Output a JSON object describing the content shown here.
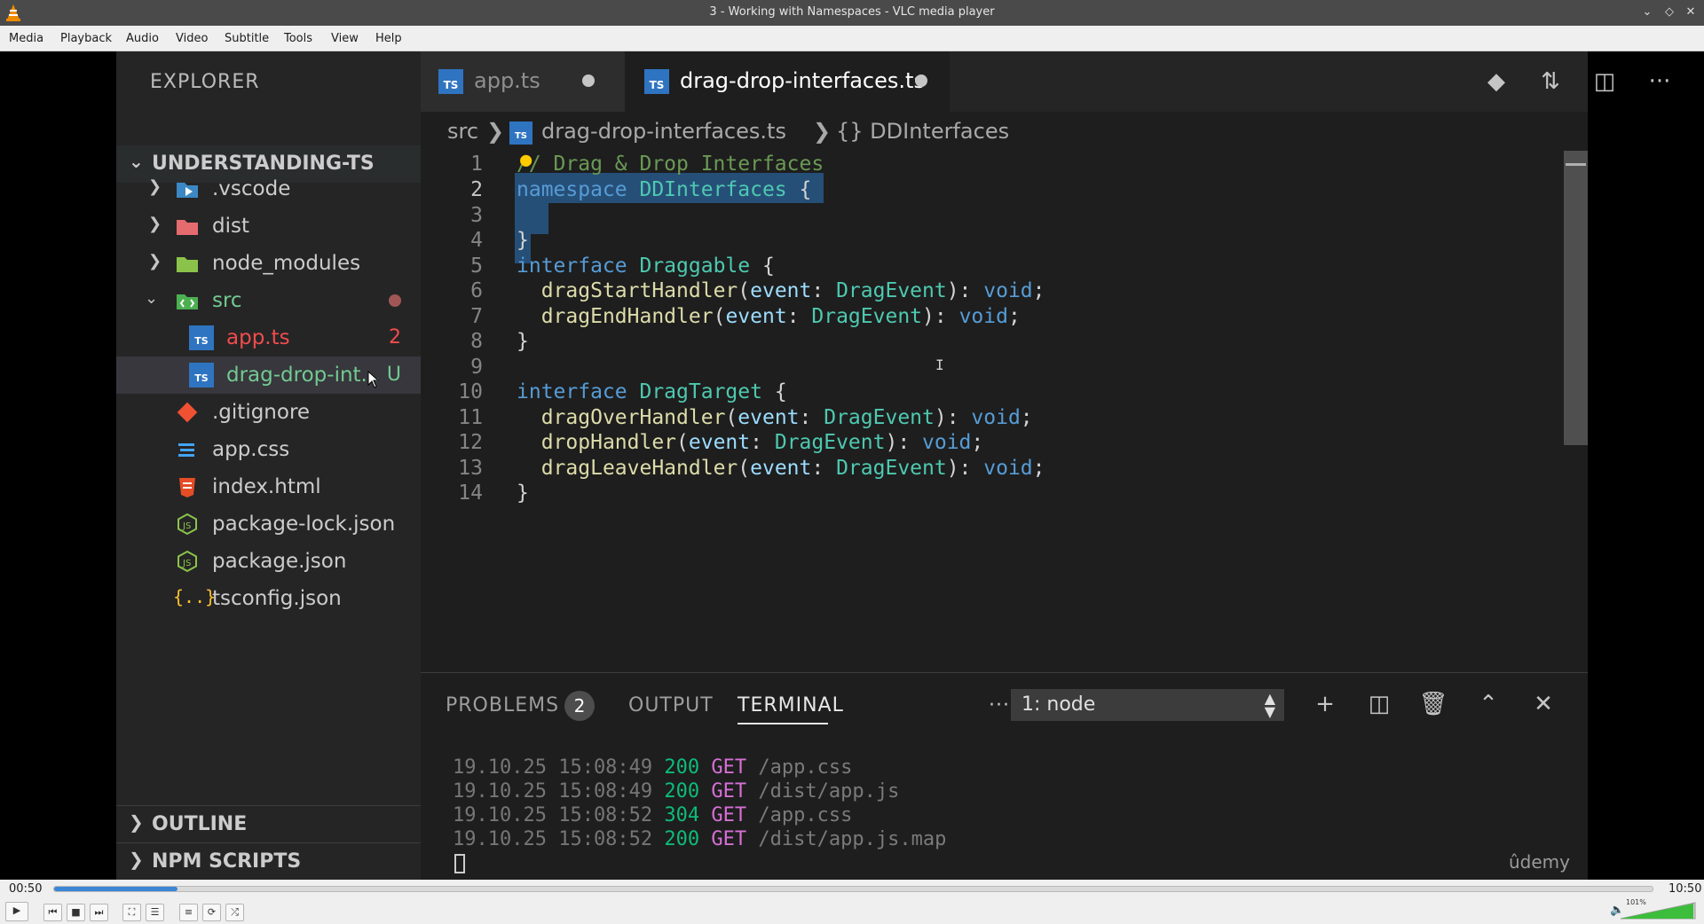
{
  "window": {
    "title": "3 - Working with Namespaces - VLC media player",
    "buttons": [
      "minimize",
      "maximize",
      "close"
    ]
  },
  "menu": [
    "Media",
    "Playback",
    "Audio",
    "Video",
    "Subtitle",
    "Tools",
    "View",
    "Help"
  ],
  "explorer": {
    "header": "EXPLORER",
    "project": "UNDERSTANDING-TS",
    "items": [
      {
        "name": ".vscode",
        "color": "#cccccc"
      },
      {
        "name": "dist",
        "color": "#cccccc"
      },
      {
        "name": "node_modules",
        "color": "#cccccc"
      },
      {
        "name": "src",
        "color": "#73c991"
      },
      {
        "name": "app.ts",
        "badge": "2",
        "color": "#f14c4c"
      },
      {
        "name": "drag-drop-int...",
        "badge": "U",
        "color": "#73c991"
      },
      {
        "name": ".gitignore",
        "color": "#cccccc"
      },
      {
        "name": "app.css",
        "color": "#cccccc"
      },
      {
        "name": "index.html",
        "color": "#cccccc"
      },
      {
        "name": "package-lock.json",
        "color": "#cccccc"
      },
      {
        "name": "package.json",
        "color": "#cccccc"
      },
      {
        "name": "tsconfig.json",
        "color": "#cccccc"
      }
    ],
    "outline": "OUTLINE",
    "npm_scripts": "NPM SCRIPTS"
  },
  "tabs": [
    {
      "name": "app.ts",
      "icon": "TS"
    },
    {
      "name": "drag-drop-interfaces.ts",
      "icon": "TS"
    }
  ],
  "breadcrumb": {
    "folder": "src",
    "file": "drag-drop-interfaces.ts",
    "symbol": "{} DDInterfaces"
  },
  "code": {
    "line_numbers": [
      "1",
      "2",
      "3",
      "4",
      "5",
      "6",
      "7",
      "8",
      "9",
      "10",
      "11",
      "12",
      "13",
      "14"
    ],
    "comment": "// Drag & Drop Interfaces",
    "kw_namespace": "namespace",
    "kw_interface": "interface",
    "ns_name": "DDInterfaces",
    "i1_name": "Draggable",
    "i2_name": "DragTarget",
    "open_brace": "{",
    "close_brace": "}",
    "void": "void",
    "event_param": "event",
    "event_type": "DragEvent",
    "m1": "dragStartHandler",
    "m2": "dragEndHandler",
    "m3": "dragOverHandler",
    "m4": "dropHandler",
    "m5": "dragLeaveHandler"
  },
  "panel": {
    "problems": "PROBLEMS",
    "problems_count": "2",
    "output": "OUTPUT",
    "terminal": "TERMINAL",
    "more": "···",
    "terminal_select": "1: node",
    "log": [
      {
        "ts": "19.10.25 15:08:49",
        "code": "200",
        "method": "GET",
        "path": "/app.css"
      },
      {
        "ts": "19.10.25 15:08:49",
        "code": "200",
        "method": "GET",
        "path": "/dist/app.js"
      },
      {
        "ts": "19.10.25 15:08:52",
        "code": "304",
        "method": "GET",
        "path": "/app.css"
      },
      {
        "ts": "19.10.25 15:08:52",
        "code": "200",
        "method": "GET",
        "path": "/dist/app.js.map"
      }
    ]
  },
  "watermark": "ûdemy",
  "player": {
    "elapsed": "00:50",
    "total": "10:50",
    "progress": 0.077,
    "volume": "101%"
  }
}
